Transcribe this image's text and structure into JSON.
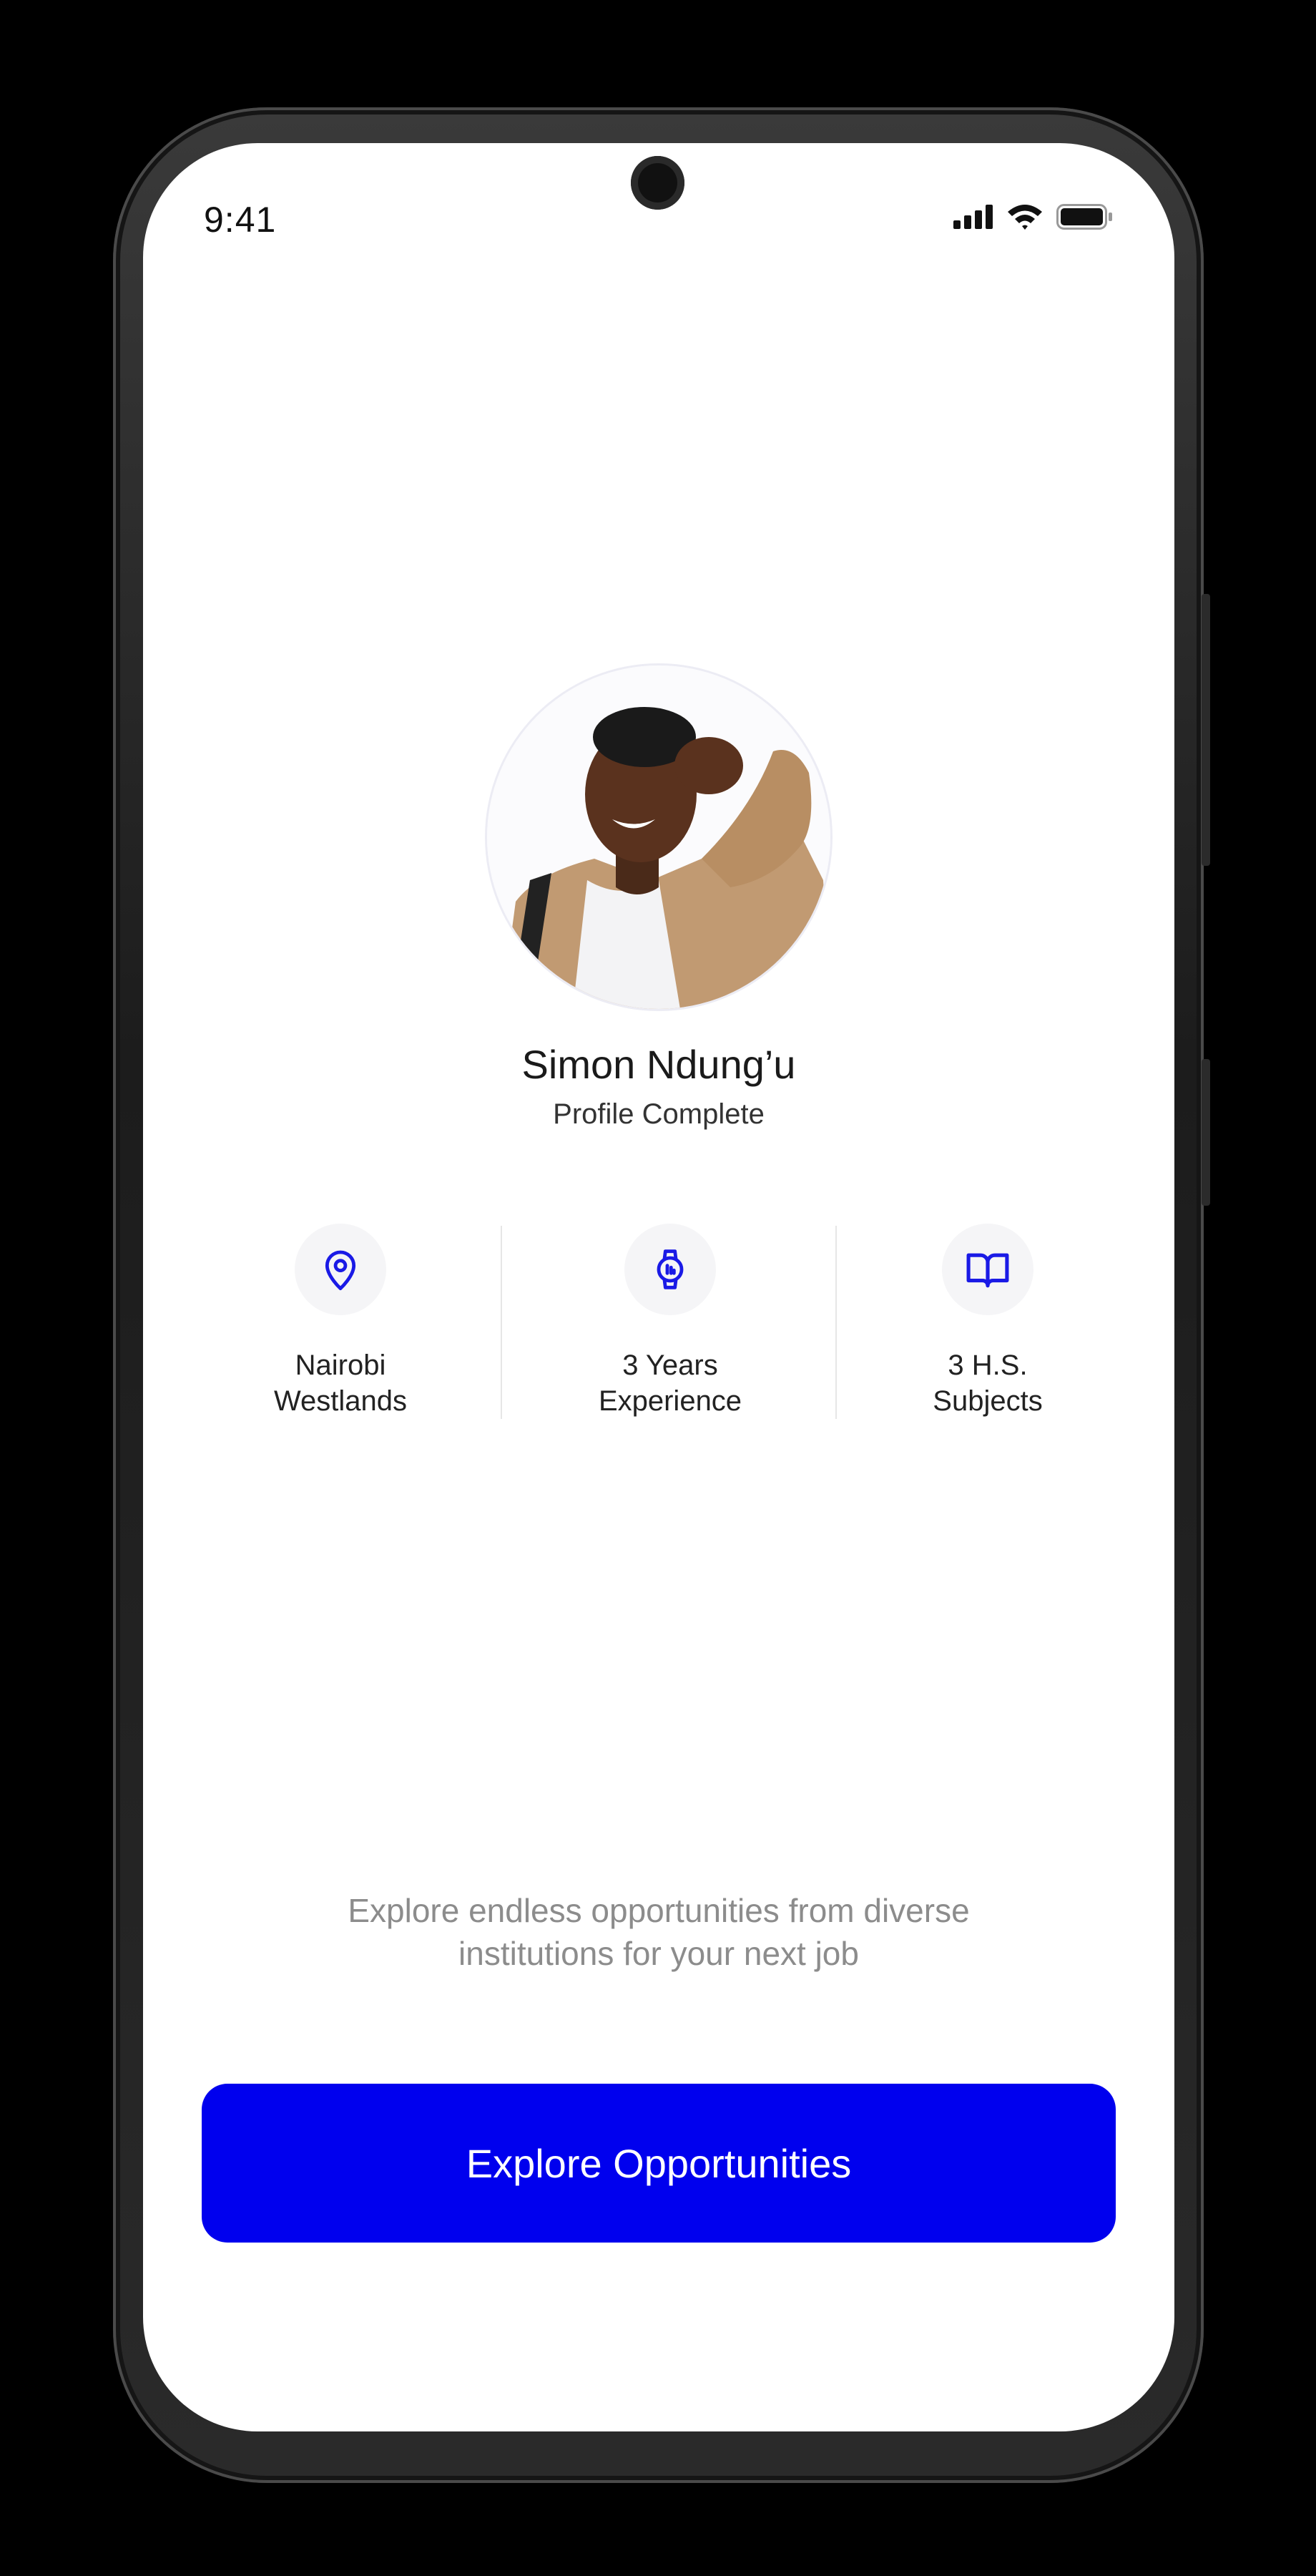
{
  "status_bar": {
    "time": "9:41"
  },
  "profile": {
    "name": "Simon Ndung’u",
    "status": "Profile Complete"
  },
  "stats": [
    {
      "icon": "location-pin-icon",
      "line1": "Nairobi",
      "line2": "Westlands"
    },
    {
      "icon": "smartwatch-icon",
      "line1": "3 Years",
      "line2": "Experience"
    },
    {
      "icon": "open-book-icon",
      "line1": "3 H.S.",
      "line2": "Subjects"
    }
  ],
  "tagline": "Explore endless opportunities from diverse institutions for your next job",
  "cta": {
    "label": "Explore Opportunities"
  },
  "colors": {
    "accent": "#0000EE",
    "icon": "#1A1AE6",
    "muted_text": "#8C8C8C"
  }
}
